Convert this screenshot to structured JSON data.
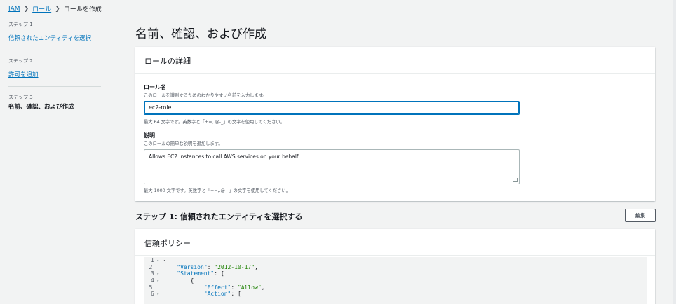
{
  "breadcrumb": {
    "items": [
      "IAM",
      "ロール"
    ],
    "current": "ロールを作成"
  },
  "steps": [
    {
      "num": "ステップ 1",
      "label": "信頼されたエンティティを選択"
    },
    {
      "num": "ステップ 2",
      "label": "許可を追加"
    },
    {
      "num": "ステップ 3",
      "label": "名前、確認、および作成"
    }
  ],
  "page_title": "名前、確認、および作成",
  "details": {
    "header": "ロールの詳細",
    "role_name_label": "ロール名",
    "role_name_desc": "このロールを識別するためのわかりやすい名前を入力します。",
    "role_name_value": "ec2-role",
    "role_name_hint": "最大 64 文字です。英数字と「+=,.@-_」の文字を使用してください。",
    "description_label": "説明",
    "description_desc": "このロールの簡単な説明を追加します。",
    "description_value": "Allows EC2 instances to call AWS services on your behalf.",
    "description_hint": "最大 1000 文字です。英数字と「+=,.@-_」の文字を使用してください。"
  },
  "step1_section": {
    "title": "ステップ 1: 信頼されたエンティティを選択する",
    "edit_label": "編集"
  },
  "trust_policy": {
    "header": "信頼ポリシー",
    "lines": [
      {
        "n": "1",
        "fold": true,
        "text": "{"
      },
      {
        "n": "2",
        "fold": false,
        "text": "    \"Version\": \"2012-10-17\","
      },
      {
        "n": "3",
        "fold": true,
        "text": "    \"Statement\": ["
      },
      {
        "n": "4",
        "fold": true,
        "text": "        {"
      },
      {
        "n": "5",
        "fold": false,
        "text": "            \"Effect\": \"Allow\","
      },
      {
        "n": "6",
        "fold": true,
        "text": "            \"Action\": ["
      }
    ]
  }
}
